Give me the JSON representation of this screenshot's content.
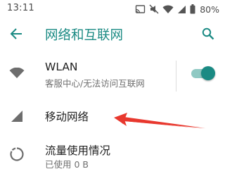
{
  "status_bar": {
    "time": "13:11",
    "battery": "80%",
    "icons": [
      "cast-icon",
      "mute-icon",
      "wifi-icon",
      "signal-icon",
      "battery-icon"
    ]
  },
  "toolbar": {
    "title": "网络和互联网",
    "accent_color": "#1a8a83",
    "back_icon": "arrow-back-icon",
    "search_icon": "search-icon"
  },
  "items": [
    {
      "title": "WLAN",
      "subtitle": "客服中心/无法访问互联网",
      "icon": "wifi-icon",
      "toggle_on": true
    },
    {
      "title": "移动网络",
      "icon": "cellular-signal-icon"
    },
    {
      "title": "流量使用情况",
      "subtitle": "已使用 0 B",
      "icon": "data-usage-icon"
    }
  ],
  "annotation": {
    "color": "#e8382e",
    "target": "移动网络"
  }
}
